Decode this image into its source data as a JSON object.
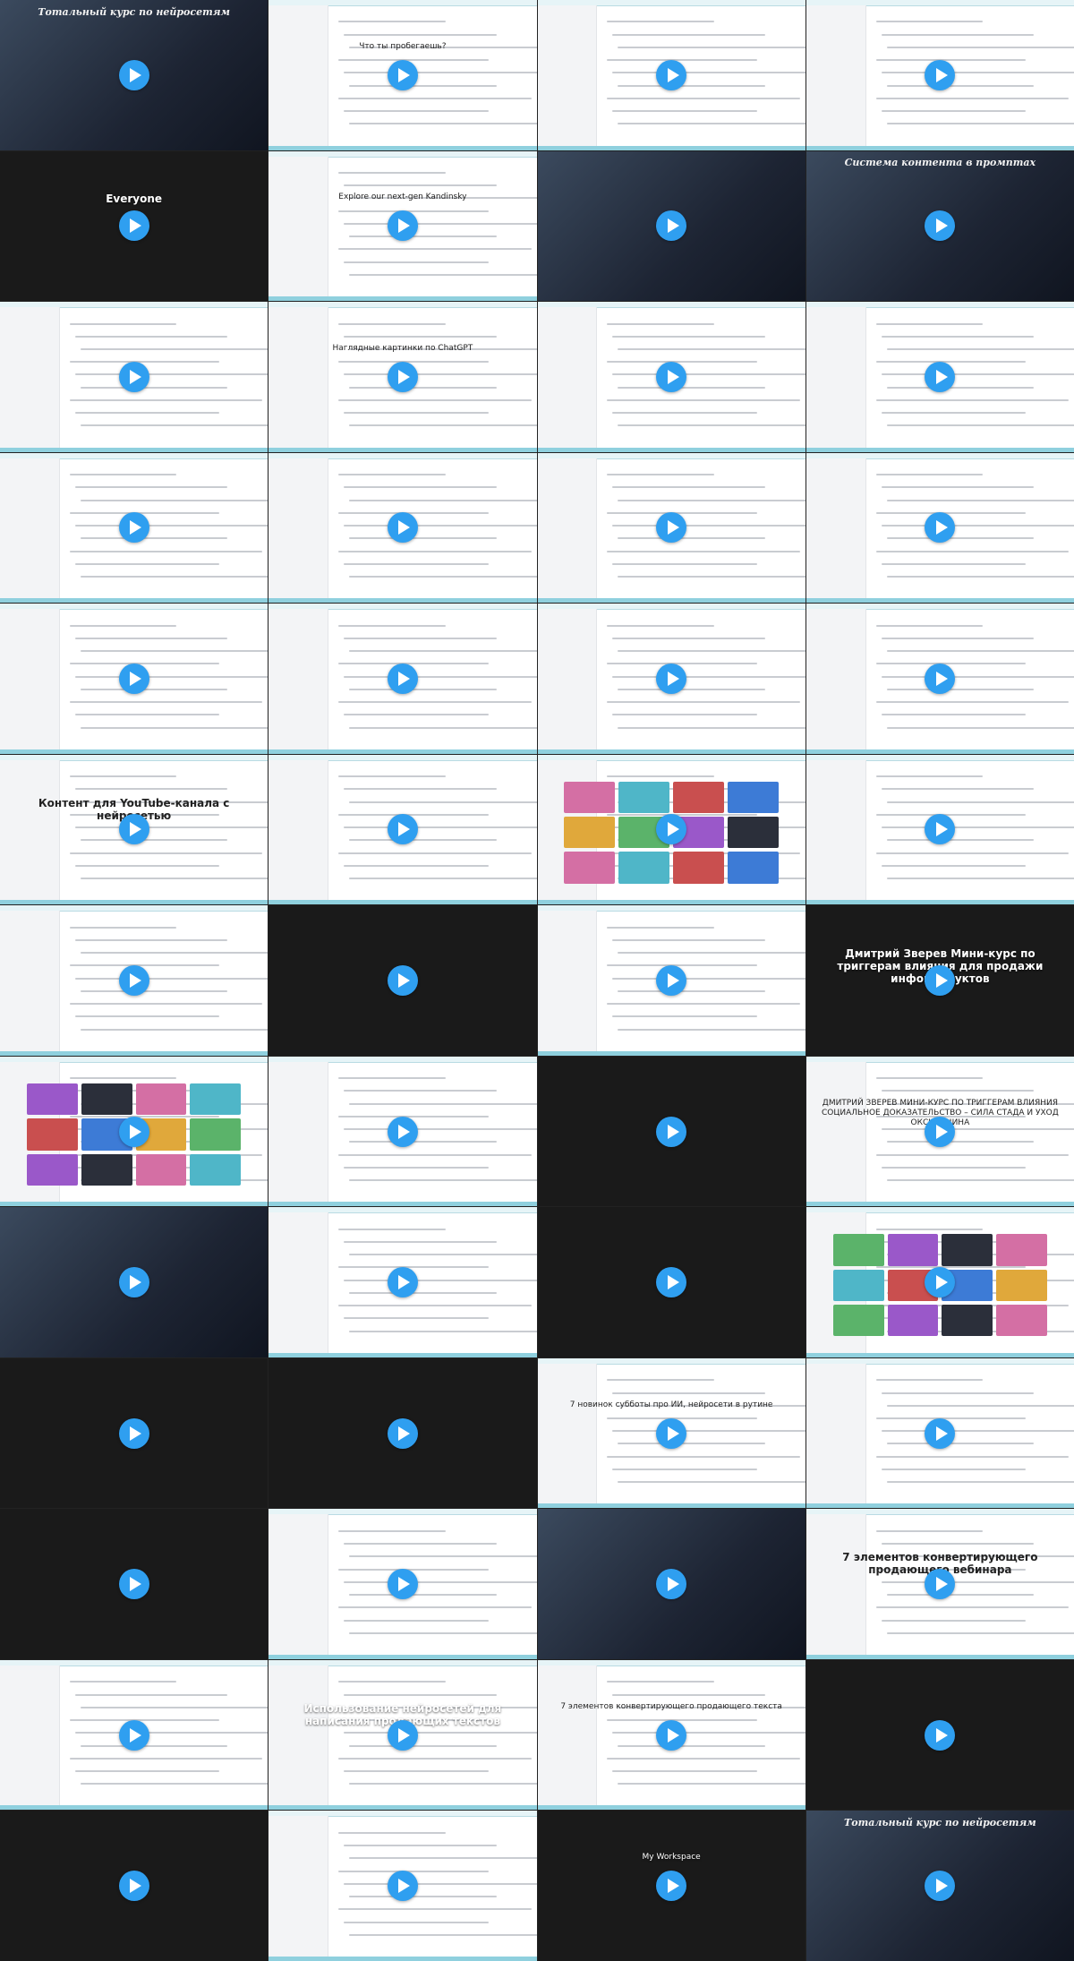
{
  "colors": {
    "play_button": "#2f9ff0",
    "screen_accent": "#8fd0de",
    "grid_gap": "#222222"
  },
  "icons": {
    "play": "play-icon"
  },
  "grid": {
    "columns": 4,
    "rows": 13
  },
  "tiles": [
    {
      "kind": "video",
      "caption": "Тотальный курс по нейросетям",
      "cap_style": "script"
    },
    {
      "kind": "screen",
      "caption": "Что ты пробегаешь?",
      "cap_style": "small"
    },
    {
      "kind": "screen",
      "caption": "",
      "cap_style": ""
    },
    {
      "kind": "screen",
      "caption": "",
      "cap_style": ""
    },
    {
      "kind": "dark",
      "caption": "Everyone",
      "cap_style": "light"
    },
    {
      "kind": "screen",
      "caption": "Explore our next-gen Kandinsky",
      "cap_style": "small"
    },
    {
      "kind": "video",
      "caption": "",
      "cap_style": ""
    },
    {
      "kind": "video",
      "caption": "Система контента в промптах",
      "cap_style": "script"
    },
    {
      "kind": "screen",
      "caption": "",
      "cap_style": ""
    },
    {
      "kind": "screen",
      "caption": "Наглядные картинки по ChatGPT",
      "cap_style": "small"
    },
    {
      "kind": "screen",
      "caption": "",
      "cap_style": ""
    },
    {
      "kind": "screen",
      "caption": "",
      "cap_style": ""
    },
    {
      "kind": "screen",
      "caption": "",
      "cap_style": ""
    },
    {
      "kind": "screen",
      "caption": "",
      "cap_style": ""
    },
    {
      "kind": "screen",
      "caption": "",
      "cap_style": ""
    },
    {
      "kind": "screen",
      "caption": "",
      "cap_style": ""
    },
    {
      "kind": "screen",
      "caption": "",
      "cap_style": ""
    },
    {
      "kind": "screen",
      "caption": "",
      "cap_style": ""
    },
    {
      "kind": "screen",
      "caption": "",
      "cap_style": ""
    },
    {
      "kind": "screen",
      "caption": "",
      "cap_style": ""
    },
    {
      "kind": "screen",
      "caption": "Контент для YouTube-канала с нейросетью",
      "cap_style": ""
    },
    {
      "kind": "screen",
      "caption": "",
      "cap_style": ""
    },
    {
      "kind": "screen",
      "caption": "",
      "cap_style": "thumbs"
    },
    {
      "kind": "screen",
      "caption": "",
      "cap_style": ""
    },
    {
      "kind": "screen",
      "caption": "",
      "cap_style": ""
    },
    {
      "kind": "dark",
      "caption": "",
      "cap_style": ""
    },
    {
      "kind": "screen",
      "caption": "",
      "cap_style": ""
    },
    {
      "kind": "dark",
      "caption": "Дмитрий Зверев Мини-курс по триггерам влияния для продажи инфопродуктов",
      "cap_style": "light"
    },
    {
      "kind": "screen",
      "caption": "",
      "cap_style": "thumbs"
    },
    {
      "kind": "screen",
      "caption": "",
      "cap_style": ""
    },
    {
      "kind": "dark",
      "caption": "",
      "cap_style": ""
    },
    {
      "kind": "screen",
      "caption": "ДМИТРИЙ ЗВЕРЕВ МИНИ-КУРС ПО ТРИГГЕРАМ ВЛИЯНИЯ СОЦИАЛЬНОЕ ДОКАЗАТЕЛЬСТВО – СИЛА СТАДА И УХОД ОКСИТОЦИНА",
      "cap_style": "small"
    },
    {
      "kind": "video",
      "caption": "",
      "cap_style": ""
    },
    {
      "kind": "screen",
      "caption": "",
      "cap_style": ""
    },
    {
      "kind": "dark",
      "caption": "",
      "cap_style": ""
    },
    {
      "kind": "screen",
      "caption": "",
      "cap_style": "thumbs"
    },
    {
      "kind": "dark",
      "caption": "",
      "cap_style": ""
    },
    {
      "kind": "dark",
      "caption": "",
      "cap_style": ""
    },
    {
      "kind": "screen",
      "caption": "7 новинок субботы про ИИ, нейросети в рутине",
      "cap_style": "small"
    },
    {
      "kind": "screen",
      "caption": "",
      "cap_style": ""
    },
    {
      "kind": "dark",
      "caption": "",
      "cap_style": ""
    },
    {
      "kind": "screen",
      "caption": "",
      "cap_style": ""
    },
    {
      "kind": "video",
      "caption": "",
      "cap_style": ""
    },
    {
      "kind": "screen",
      "caption": "7 элементов конвертирующего продающего вебинара",
      "cap_style": ""
    },
    {
      "kind": "screen",
      "caption": "",
      "cap_style": ""
    },
    {
      "kind": "screen",
      "caption": "Использование нейросетей для написания продающих текстов",
      "cap_style": "light"
    },
    {
      "kind": "screen",
      "caption": "7 элементов конвертирующего продающего текста",
      "cap_style": "small"
    },
    {
      "kind": "dark",
      "caption": "",
      "cap_style": ""
    },
    {
      "kind": "dark",
      "caption": "",
      "cap_style": ""
    },
    {
      "kind": "screen",
      "caption": "",
      "cap_style": ""
    },
    {
      "kind": "dark",
      "caption": "My Workspace",
      "cap_style": "small"
    },
    {
      "kind": "video",
      "caption": "Тотальный курс по нейросетям",
      "cap_style": "script"
    }
  ]
}
